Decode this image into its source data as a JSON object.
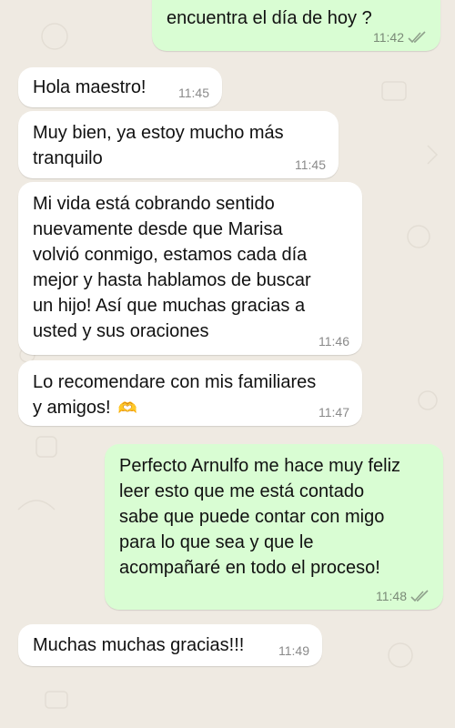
{
  "messages": [
    {
      "direction": "out",
      "text": "encuentra el día de hoy ?",
      "time": "11:42",
      "ticks": "read-ticks"
    },
    {
      "direction": "in",
      "text": "Hola maestro!",
      "time": "11:45"
    },
    {
      "direction": "in",
      "text": "Muy bien, ya estoy mucho más\ntranquilo",
      "time": "11:45"
    },
    {
      "direction": "in",
      "text": "Mi vida está cobrando sentido\nnuevamente desde que Marisa\nvolvió conmigo, estamos cada día\nmejor y hasta hablamos de buscar\nun hijo! Así que muchas gracias a\nusted y sus oraciones",
      "time": "11:46"
    },
    {
      "direction": "in",
      "text": "Lo recomendare con mis familiares\ny amigos!",
      "emoji": "🫶",
      "time": "11:47"
    },
    {
      "direction": "out",
      "text": "Perfecto Arnulfo me hace muy feliz\nleer esto que me está contado\nsabe que puede contar con migo\npara lo que sea y que le\nacompañaré en todo el proceso!",
      "time": "11:48",
      "ticks": "read-ticks"
    },
    {
      "direction": "in",
      "text": "Muchas muchas gracias!!!",
      "time": "11:49"
    }
  ],
  "colors": {
    "background": "#efeae2",
    "incoming_bubble": "#ffffff",
    "outgoing_bubble": "#d9fdd3",
    "timestamp": "#8a8a8a",
    "ticks": "#8fa08c"
  }
}
